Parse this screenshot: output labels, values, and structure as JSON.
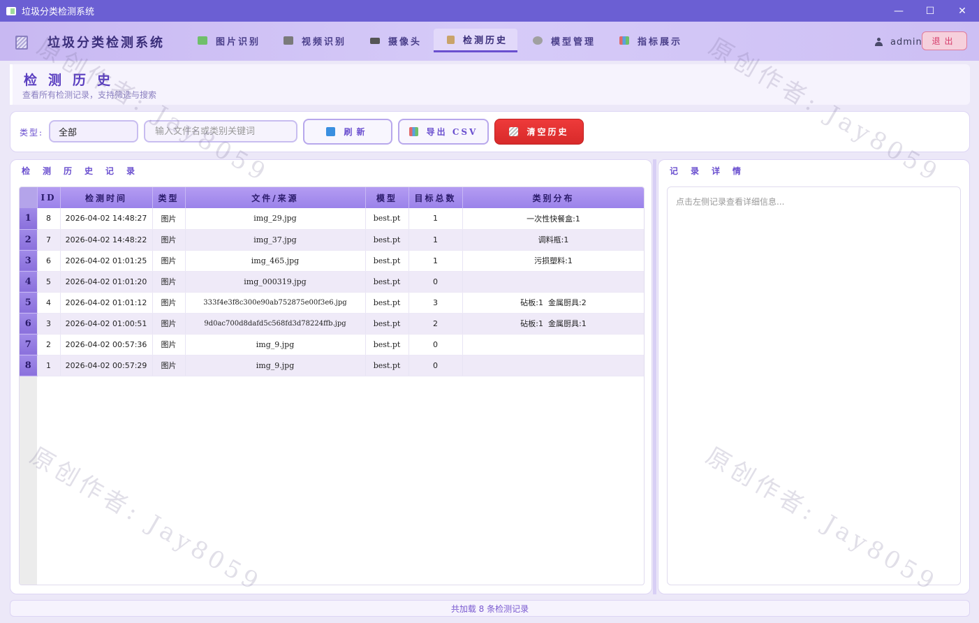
{
  "window": {
    "title": "垃圾分类检测系统",
    "controls": {
      "minimize": "—",
      "maximize": "☐",
      "close": "✕"
    }
  },
  "header": {
    "brand": "垃圾分类检测系统",
    "nav": [
      {
        "label": "图片识别",
        "icon": "image-icon",
        "color": "#6fbf6a"
      },
      {
        "label": "视频识别",
        "icon": "film-icon",
        "color": "#7a7a7a"
      },
      {
        "label": "摄像头",
        "icon": "camera-icon",
        "color": "#555555"
      },
      {
        "label": "检测历史",
        "icon": "clipboard-icon",
        "color": "#c9a36a"
      },
      {
        "label": "模型管理",
        "icon": "gear-icon",
        "color": "#a0a0a0"
      },
      {
        "label": "指标展示",
        "icon": "bar-chart-icon",
        "color": "#e06a6a"
      }
    ],
    "active_tab": "检测历史",
    "user": "admin",
    "logout": "退出"
  },
  "page": {
    "title": "检测历史",
    "subtitle": "查看所有检测记录，支持筛选与搜索"
  },
  "filters": {
    "type_label": "类型:",
    "type_value": "全部",
    "search_placeholder": "输入文件名或类别关键词",
    "refresh": "刷新",
    "export": "导出 CSV",
    "clear": "清空历史"
  },
  "history": {
    "panel_title": "检测历史记录",
    "columns": [
      "ID",
      "检测时间",
      "类型",
      "文件/来源",
      "模型",
      "目标总数",
      "类别分布"
    ],
    "rows": [
      {
        "num": "1",
        "id": "8",
        "time": "2026-04-02 14:48:27",
        "type": "图片",
        "file": "img_29.jpg",
        "model": "best.pt",
        "count": "1",
        "dist": "一次性快餐盒:1"
      },
      {
        "num": "2",
        "id": "7",
        "time": "2026-04-02 14:48:22",
        "type": "图片",
        "file": "img_37.jpg",
        "model": "best.pt",
        "count": "1",
        "dist": "调料瓶:1"
      },
      {
        "num": "3",
        "id": "6",
        "time": "2026-04-02 01:01:25",
        "type": "图片",
        "file": "img_465.jpg",
        "model": "best.pt",
        "count": "1",
        "dist": "污损塑料:1"
      },
      {
        "num": "4",
        "id": "5",
        "time": "2026-04-02 01:01:20",
        "type": "图片",
        "file": "img_000319.jpg",
        "model": "best.pt",
        "count": "0",
        "dist": ""
      },
      {
        "num": "5",
        "id": "4",
        "time": "2026-04-02 01:01:12",
        "type": "图片",
        "file": "333f4e3f8c300e90ab752875e00f3e6.jpg",
        "model": "best.pt",
        "count": "3",
        "dist": "砧板:1  金属厨具:2"
      },
      {
        "num": "6",
        "id": "3",
        "time": "2026-04-02 01:00:51",
        "type": "图片",
        "file": "9d0ac700d8dafd5c568fd3d78224ffb.jpg",
        "model": "best.pt",
        "count": "2",
        "dist": "砧板:1  金属厨具:1"
      },
      {
        "num": "7",
        "id": "2",
        "time": "2026-04-02 00:57:36",
        "type": "图片",
        "file": "img_9.jpg",
        "model": "best.pt",
        "count": "0",
        "dist": ""
      },
      {
        "num": "8",
        "id": "1",
        "time": "2026-04-02 00:57:29",
        "type": "图片",
        "file": "img_9.jpg",
        "model": "best.pt",
        "count": "0",
        "dist": ""
      }
    ]
  },
  "detail": {
    "panel_title": "记录详情",
    "placeholder": "点击左侧记录查看详细信息..."
  },
  "status": "共加载 8 条检测记录",
  "watermark": "原创作者: Jay8059"
}
